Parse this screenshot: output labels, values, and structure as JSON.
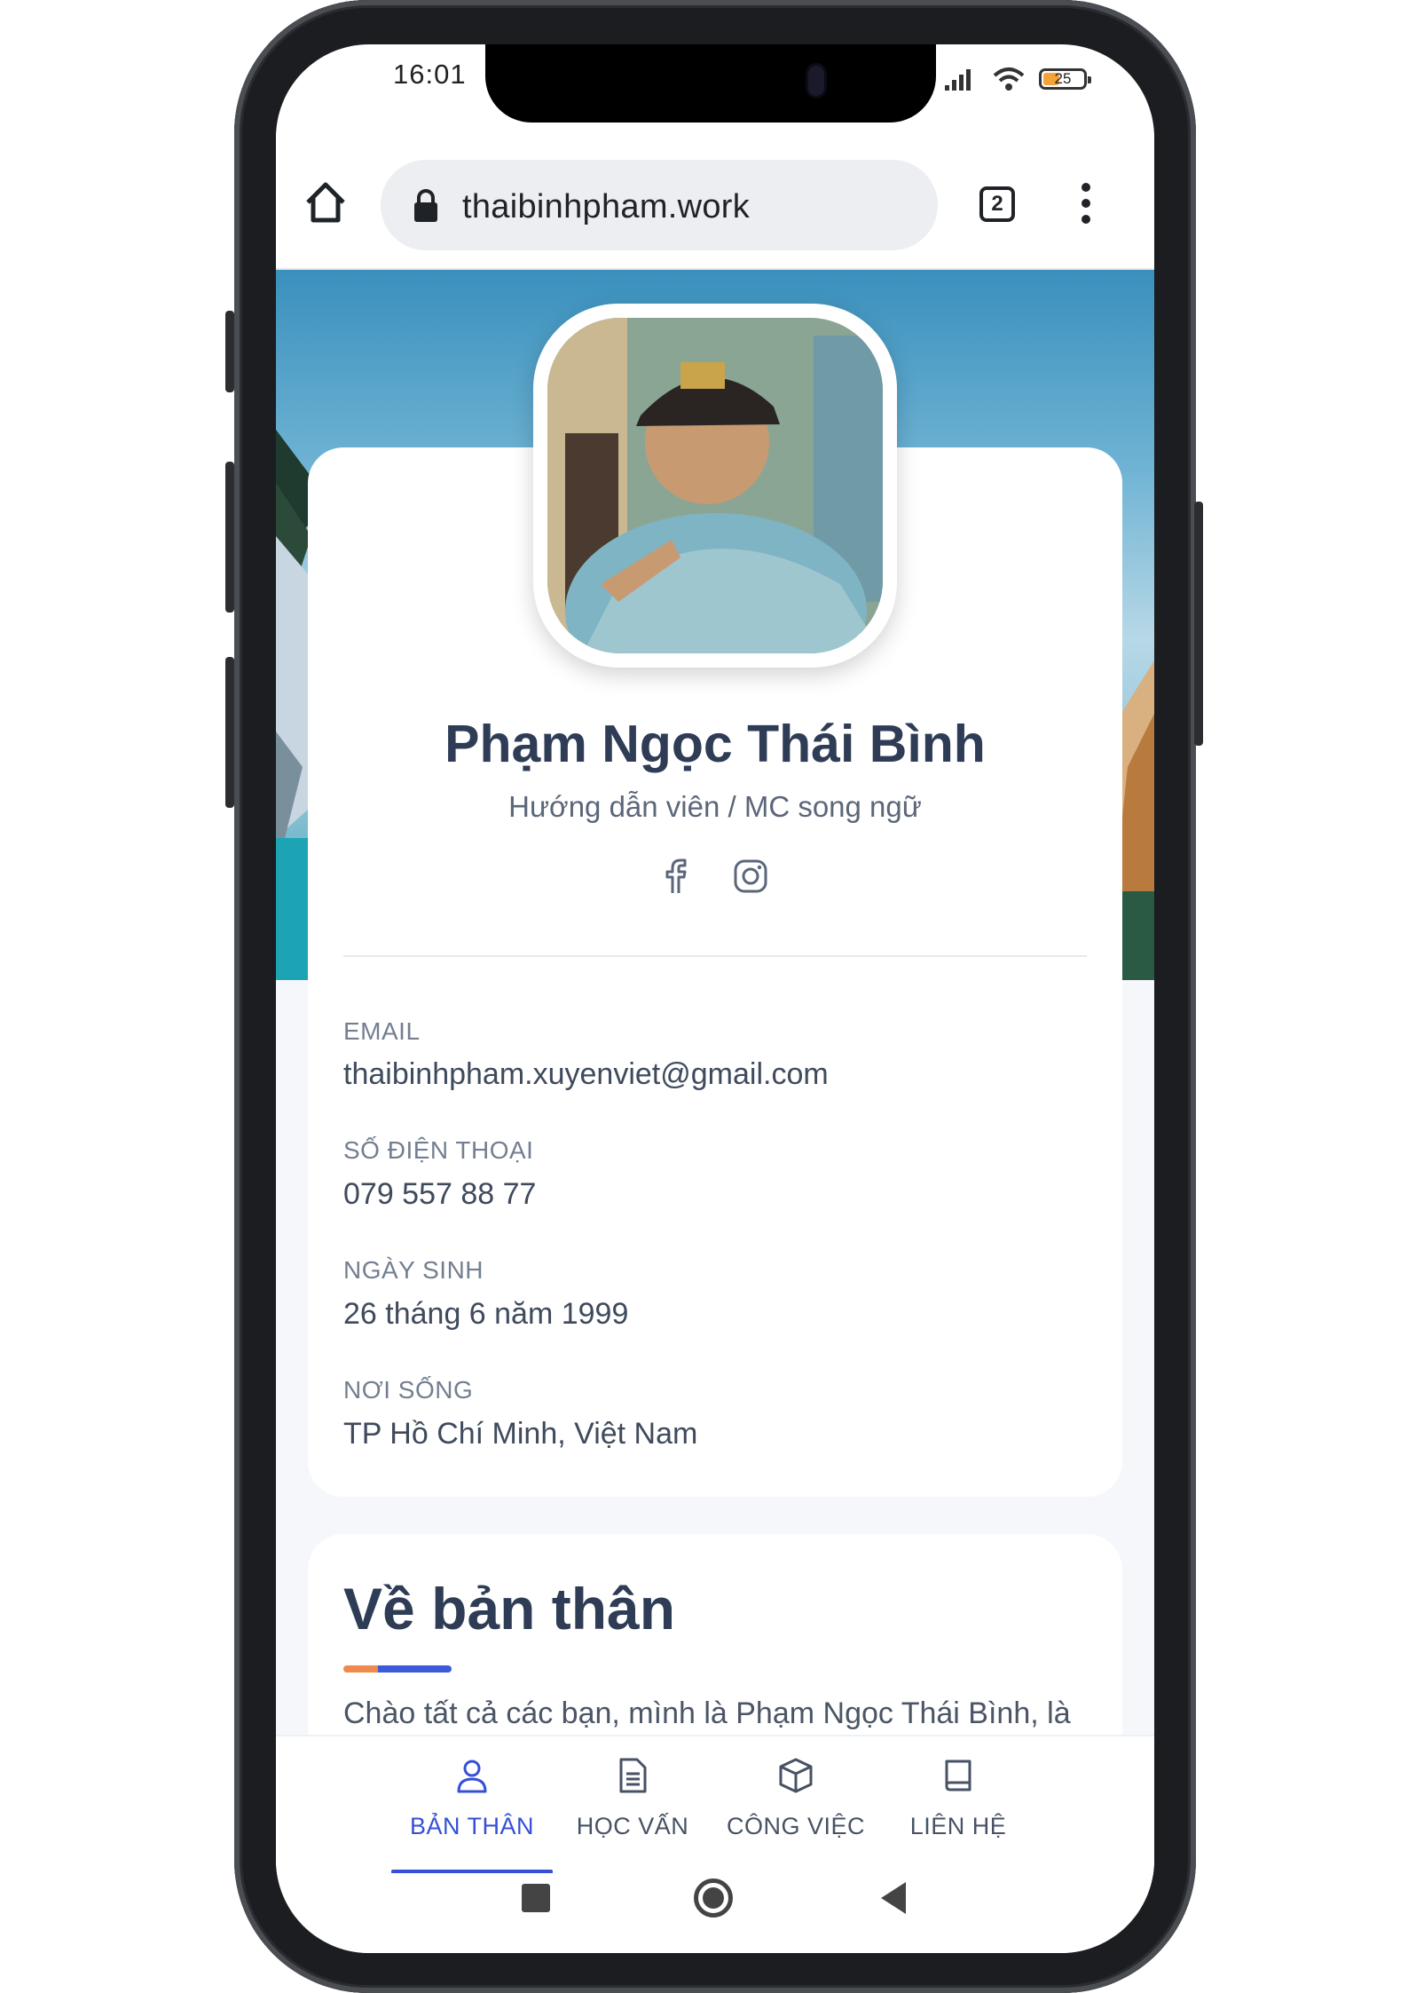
{
  "status_bar": {
    "time": "16:01",
    "battery": "25"
  },
  "browser": {
    "url": "thaibinhpham.work",
    "tab_count": "2"
  },
  "profile": {
    "name": "Phạm Ngọc Thái Bình",
    "role": "Hướng dẫn viên / MC song ngữ",
    "social": [
      "facebook-icon",
      "instagram-icon"
    ]
  },
  "info": [
    {
      "label": "EMAIL",
      "value": "thaibinhpham.xuyenviet@gmail.com"
    },
    {
      "label": "SỐ ĐIỆN THOẠI",
      "value": "079 557 88 77"
    },
    {
      "label": "NGÀY SINH",
      "value": "26 tháng 6 năm 1999"
    },
    {
      "label": "NƠI SỐNG",
      "value": "TP Hồ Chí Minh, Việt Nam"
    }
  ],
  "about": {
    "title": "Về bản thân",
    "text": "Chào tất cả các bạn, mình là Phạm Ngọc Thái Bình, là một hướng dẫn viên du lịch, MC song ngữ cũng như"
  },
  "bottom_nav": [
    {
      "label": "BẢN THÂN",
      "icon": "user-icon",
      "active": true
    },
    {
      "label": "HỌC VẤN",
      "icon": "document-icon",
      "active": false
    },
    {
      "label": "CÔNG VIỆC",
      "icon": "box-icon",
      "active": false
    },
    {
      "label": "LIÊN HỆ",
      "icon": "book-icon",
      "active": false
    }
  ],
  "colors": {
    "accent": "#3550d6",
    "accent_orange": "#f08a4b",
    "title_text": "#2e3d55"
  }
}
